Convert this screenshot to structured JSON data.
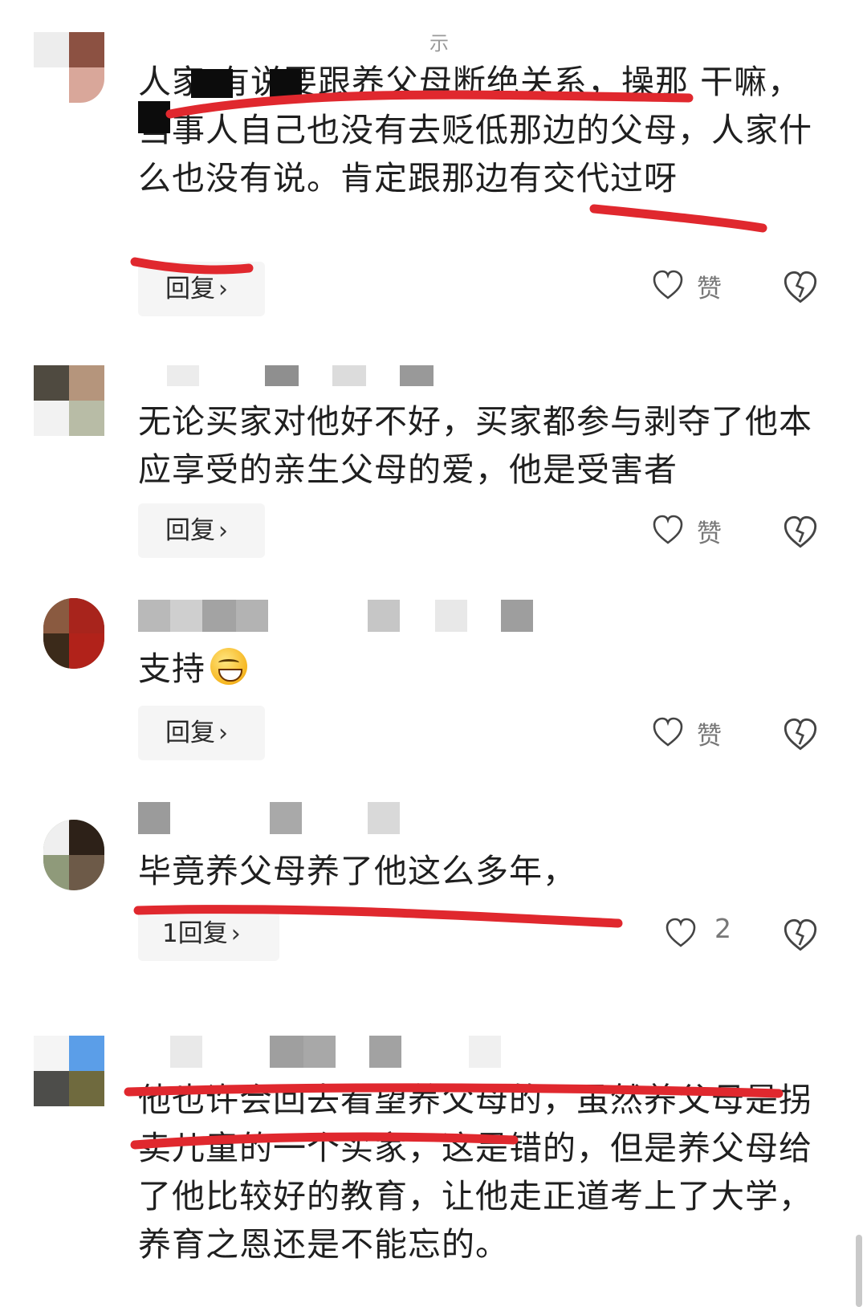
{
  "top_fragment": "示",
  "comments": [
    {
      "text": "人家 有说要跟养父母断绝关系，操那 干嘛，当事人自己也没有去贬低那边的父母，人家什么也没有说。肯定跟那边有交代过呀",
      "reply_label": "回复",
      "like_label": "赞"
    },
    {
      "text": "无论买家对他好不好，买家都参与剥夺了他本应享受的亲生父母的爱，他是受害者",
      "reply_label": "回复",
      "like_label": "赞"
    },
    {
      "text": "支持",
      "emoji": "grinning-face-emoji",
      "reply_label": "回复",
      "like_label": "赞"
    },
    {
      "text": "毕竟养父母养了他这么多年，",
      "reply_label": "1回复",
      "like_label": "2"
    },
    {
      "text": "他也许会回去看望养父母的，虽然养父母是拐卖儿童的一个买家，这是错的，但是养父母给了他比较好的教育，让他走正道考上了大学，养育之恩还是不能忘的。"
    }
  ],
  "icons": {
    "like": "heart-outline-icon",
    "dislike": "broken-heart-icon",
    "reply_arrow": "chevron-right-icon"
  },
  "colors": {
    "annotation_red": "#e0282e",
    "reply_bg": "#f5f5f5",
    "text": "#1f1f1f"
  }
}
